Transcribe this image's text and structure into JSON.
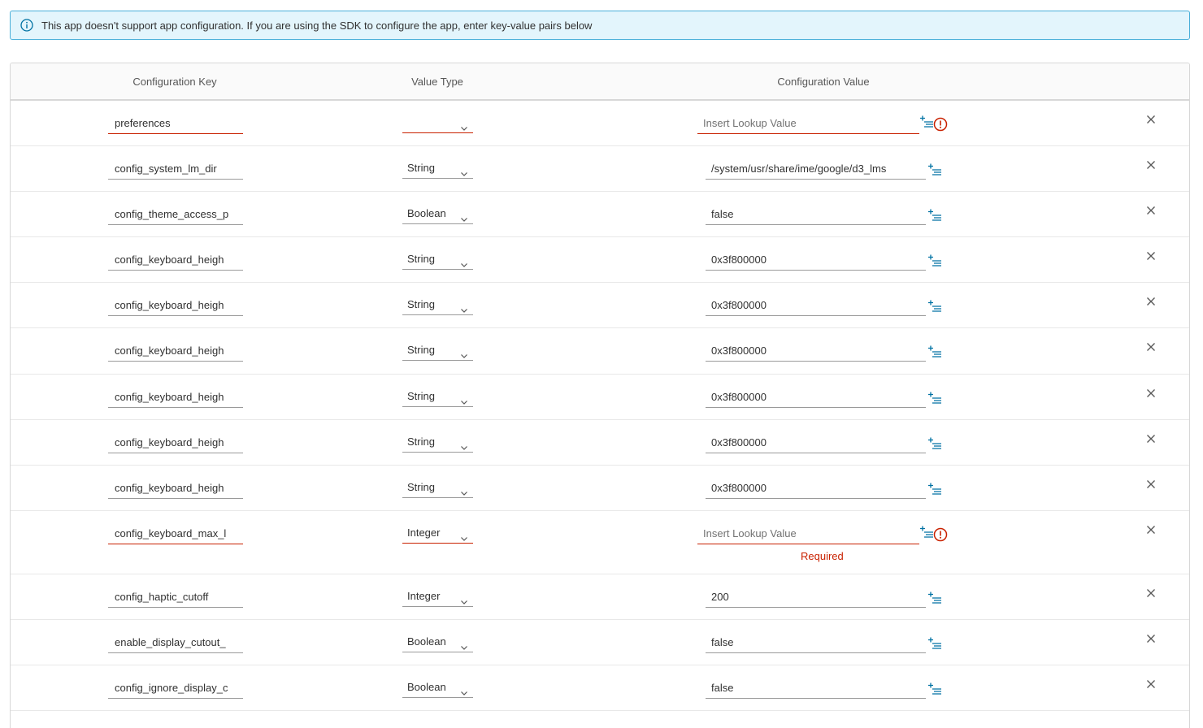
{
  "banner": {
    "icon": "info-icon",
    "text": "This app doesn't support app configuration. If you are using the SDK to configure the app, enter key-value pairs below"
  },
  "grid": {
    "columns": {
      "key": "Configuration Key",
      "type": "Value Type",
      "value": "Configuration Value"
    },
    "rows": [
      {
        "key": "preferences",
        "type": "",
        "value": "",
        "placeholder": "Insert Lookup Value",
        "error": true
      },
      {
        "key": "config_system_lm_dir",
        "type": "String",
        "value": "/system/usr/share/ime/google/d3_lms"
      },
      {
        "key": "config_theme_access_p",
        "type": "Boolean",
        "value": "false"
      },
      {
        "key": "config_keyboard_heigh",
        "type": "String",
        "value": "0x3f800000"
      },
      {
        "key": "config_keyboard_heigh",
        "type": "String",
        "value": "0x3f800000"
      },
      {
        "key": "config_keyboard_heigh",
        "type": "String",
        "value": "0x3f800000"
      },
      {
        "key": "config_keyboard_heigh",
        "type": "String",
        "value": "0x3f800000"
      },
      {
        "key": "config_keyboard_heigh",
        "type": "String",
        "value": "0x3f800000"
      },
      {
        "key": "config_keyboard_heigh",
        "type": "String",
        "value": "0x3f800000"
      },
      {
        "key": "config_keyboard_max_l",
        "type": "Integer",
        "value": "",
        "placeholder": "Insert Lookup Value",
        "error": true,
        "required": "Required"
      },
      {
        "key": "config_haptic_cutoff",
        "type": "Integer",
        "value": "200"
      },
      {
        "key": "enable_display_cutout_",
        "type": "Boolean",
        "value": "false"
      },
      {
        "key": "config_ignore_display_c",
        "type": "Boolean",
        "value": "false"
      }
    ]
  },
  "colors": {
    "accent": "#49afd9",
    "error": "#c92100",
    "icon_blue": "#0072a3"
  },
  "icons": {
    "lookup": "insert-lookup-icon",
    "error": "exclamation-circle-icon",
    "remove": "close-icon",
    "dropdown": "chevron-down-icon"
  }
}
